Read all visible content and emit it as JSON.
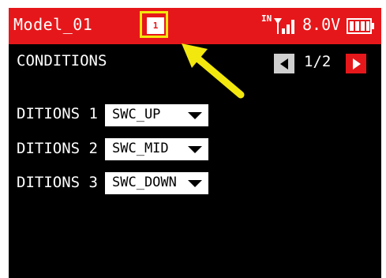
{
  "header": {
    "model_name": "Model_01",
    "model_icon_text": "1",
    "signal_label": "IN",
    "voltage": "8.0V",
    "background_color": "#e6171a"
  },
  "page": {
    "title": "CONDITIONS",
    "indicator": "1/2"
  },
  "conditions": [
    {
      "label": "DITIONS 1",
      "value": "SWC_UP"
    },
    {
      "label": "DITIONS 2",
      "value": "SWC_MID"
    },
    {
      "label": "DITIONS 3",
      "value": "SWC_DOWN"
    }
  ],
  "annotation": {
    "highlight_color": "#f3e80e",
    "arrow_icon": "yellow-arrow-pointing-to-model-icon"
  },
  "icons": {
    "signal": "signal-strength-icon",
    "battery": "battery-icon",
    "prev": "chevron-left-icon",
    "next": "chevron-right-icon",
    "dropdown": "chevron-down-icon"
  }
}
